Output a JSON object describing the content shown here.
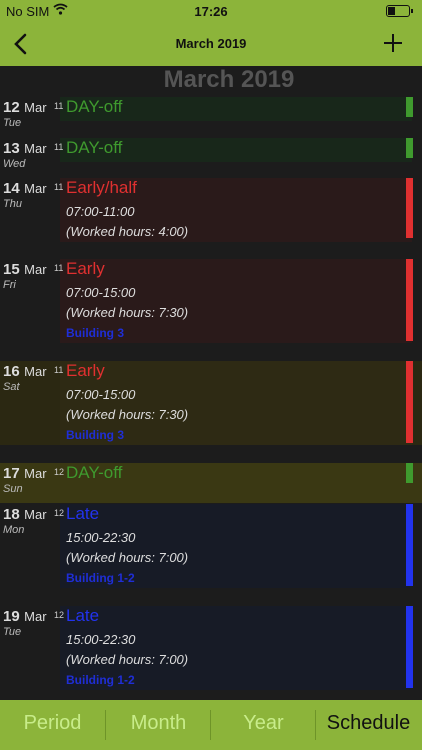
{
  "status": {
    "carrier": "No SIM",
    "time": "17:26"
  },
  "nav": {
    "title": "March 2019"
  },
  "month_header": "March 2019",
  "days": [
    {
      "day": "12",
      "month": "Mar",
      "dow": "Tue",
      "week": "11",
      "shift": "DAY-off",
      "shift_color": "#3f9a2e",
      "hours": "",
      "worked": "",
      "building": ""
    },
    {
      "day": "13",
      "month": "Mar",
      "dow": "Wed",
      "week": "11",
      "shift": "DAY-off",
      "shift_color": "#3f9a2e",
      "hours": "",
      "worked": "",
      "building": ""
    },
    {
      "day": "14",
      "month": "Mar",
      "dow": "Thu",
      "week": "11",
      "shift": "Early/half",
      "shift_color": "#e03030",
      "hours": "07:00-11:00",
      "worked": "(Worked hours: 4:00)",
      "building": ""
    },
    {
      "day": "15",
      "month": "Mar",
      "dow": "Fri",
      "week": "11",
      "shift": "Early",
      "shift_color": "#e03030",
      "hours": "07:00-15:00",
      "worked": "(Worked hours: 7:30)",
      "building": "Building 3"
    },
    {
      "day": "16",
      "month": "Mar",
      "dow": "Sat",
      "week": "11",
      "shift": "Early",
      "shift_color": "#e03030",
      "hours": "07:00-15:00",
      "worked": "(Worked hours: 7:30)",
      "building": "Building 3"
    },
    {
      "day": "17",
      "month": "Mar",
      "dow": "Sun",
      "week": "12",
      "shift": "DAY-off",
      "shift_color": "#3f9a2e",
      "hours": "",
      "worked": "",
      "building": ""
    },
    {
      "day": "18",
      "month": "Mar",
      "dow": "Mon",
      "week": "12",
      "shift": "Late",
      "shift_color": "#2233ee",
      "hours": "15:00-22:30",
      "worked": "(Worked hours: 7:00)",
      "building": "Building 1-2"
    },
    {
      "day": "19",
      "month": "Mar",
      "dow": "Tue",
      "week": "12",
      "shift": "Late",
      "shift_color": "#2233ee",
      "hours": "15:00-22:30",
      "worked": "(Worked hours: 7:00)",
      "building": "Building 1-2"
    }
  ],
  "tabs": [
    {
      "label": "Period",
      "active": false
    },
    {
      "label": "Month",
      "active": false
    },
    {
      "label": "Year",
      "active": false
    },
    {
      "label": "Schedule",
      "active": true
    }
  ]
}
